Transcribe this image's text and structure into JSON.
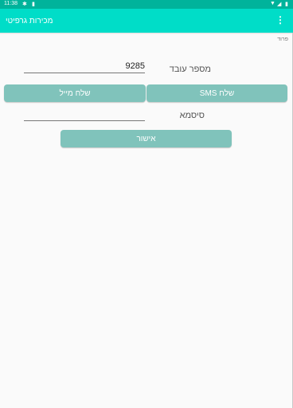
{
  "status_bar": {
    "time": "11:38",
    "icons": [
      "settings-gear-icon",
      "sd-card-icon",
      "wifi-icon",
      "signal-icon",
      "battery-icon"
    ]
  },
  "app_bar": {
    "title": "מכירות גרפיטי",
    "menu_icon": "more-vert-icon"
  },
  "logout": "פרוד",
  "employee": {
    "label": "מספר עובד",
    "value": "9285"
  },
  "buttons": {
    "send_sms": "שלח SMS",
    "send_mail": "שלח מייל",
    "confirm": "אישור"
  },
  "password": {
    "label": "סיסמא",
    "value": ""
  },
  "colors": {
    "status_bar": "#00b39b",
    "app_bar": "#00ddc8",
    "button": "#80c3bb",
    "background": "#fafafa"
  }
}
